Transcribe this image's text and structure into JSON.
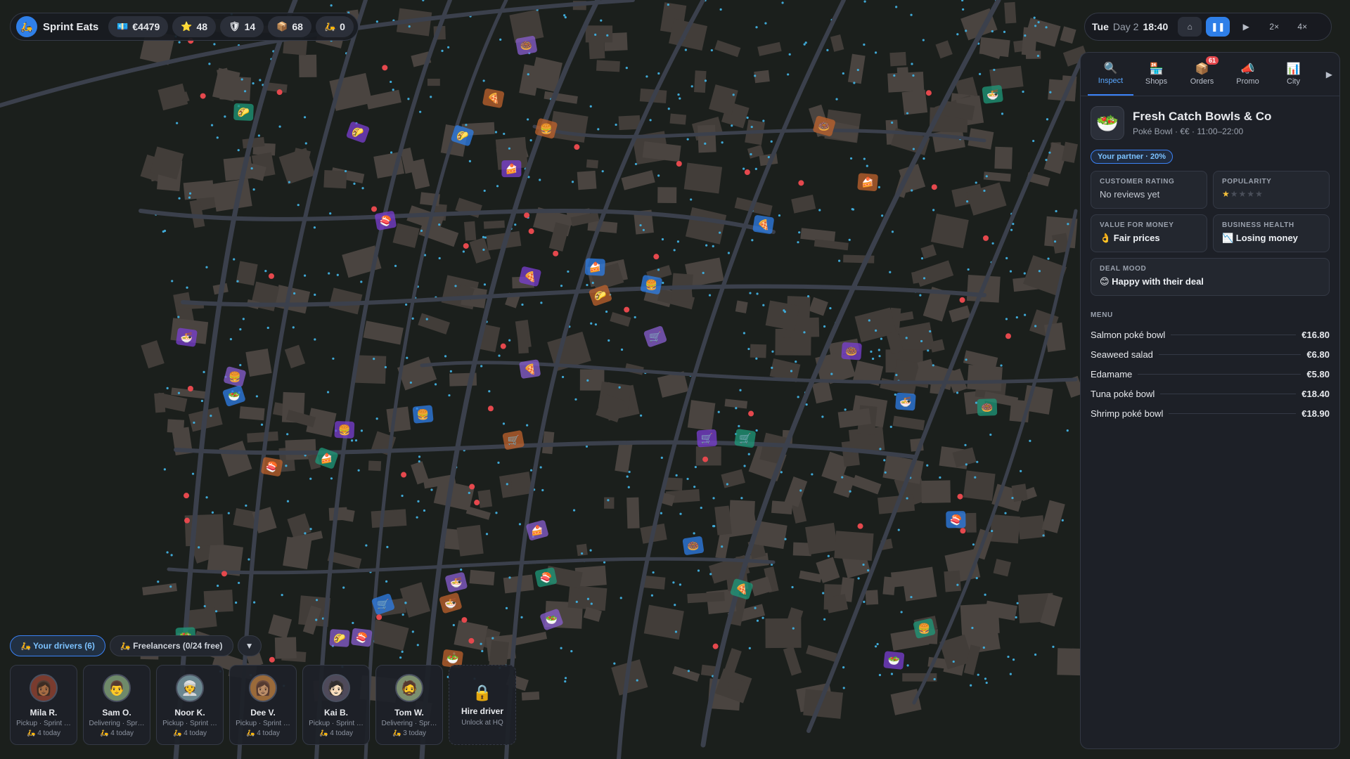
{
  "topbar": {
    "brand": "Sprint Eats",
    "stats": [
      {
        "icon": "cash-icon",
        "glyph": "💶",
        "value": "€4479"
      },
      {
        "icon": "star-icon",
        "glyph": "⭐",
        "value": "48"
      },
      {
        "icon": "shield-icon",
        "glyph": "🛡",
        "value": "14"
      },
      {
        "icon": "package-icon",
        "glyph": "📦",
        "value": "68"
      },
      {
        "icon": "scooter-icon",
        "glyph": "🛵",
        "value": "0"
      }
    ]
  },
  "time": {
    "weekday": "Tue",
    "day": "Day 2",
    "clock": "18:40",
    "home_glyph": "⌂",
    "pause_glyph": "❚❚",
    "play_glyph": "▶",
    "speed2": "2×",
    "speed4": "4×"
  },
  "panel": {
    "tabs": [
      {
        "label": "Inspect",
        "glyph": "🔍",
        "active": true
      },
      {
        "label": "Shops",
        "glyph": "🏪"
      },
      {
        "label": "Orders",
        "glyph": "📦",
        "badge": "61"
      },
      {
        "label": "Promo",
        "glyph": "📣"
      },
      {
        "label": "City",
        "glyph": "📊"
      }
    ],
    "more_glyph": "▶",
    "shop": {
      "icon": "poke-bowl-icon",
      "glyph": "🥗",
      "name": "Fresh Catch Bowls & Co",
      "subtitle": "Poké Bowl · €€ · 11:00–22:00",
      "partner": "Your partner · 20%"
    },
    "cards": {
      "rating_label": "Customer rating",
      "rating_value": "No reviews yet",
      "popularity_label": "Popularity",
      "popularity_stars": 1,
      "value_label": "Value for money",
      "value_value": "👌 Fair prices",
      "health_label": "Business health",
      "health_value": "📉 Losing money",
      "mood_label": "Deal mood",
      "mood_value": "😊 Happy with their deal"
    },
    "menu_title": "Menu",
    "menu": [
      {
        "name": "Salmon poké bowl",
        "price": "€16.80"
      },
      {
        "name": "Seaweed salad",
        "price": "€6.80"
      },
      {
        "name": "Edamame",
        "price": "€5.80"
      },
      {
        "name": "Tuna poké bowl",
        "price": "€18.40"
      },
      {
        "name": "Shrimp poké bowl",
        "price": "€18.90"
      }
    ]
  },
  "driver_tabs": {
    "yours": "🛵 Your drivers (6)",
    "freelancers": "🛵 Freelancers (0/24 free)",
    "toggle": "▼"
  },
  "drivers": [
    {
      "name": "Mila R.",
      "status": "Pickup · Sprint …",
      "today": "🛵 4 today",
      "glyph": "👩🏾",
      "color": "#7a3b2e"
    },
    {
      "name": "Sam O.",
      "status": "Delivering · Spr…",
      "today": "🛵 4 today",
      "glyph": "👨",
      "color": "#6f8a6a"
    },
    {
      "name": "Noor K.",
      "status": "Pickup · Sprint …",
      "today": "🛵 4 today",
      "glyph": "👳",
      "color": "#6b8790"
    },
    {
      "name": "Dee V.",
      "status": "Pickup · Sprint …",
      "today": "🛵 4 today",
      "glyph": "👩🏽",
      "color": "#9a6a3a"
    },
    {
      "name": "Kai B.",
      "status": "Pickup · Sprint …",
      "today": "🛵 4 today",
      "glyph": "🧑🏻",
      "color": "#4f4a5a"
    },
    {
      "name": "Tom W.",
      "status": "Delivering · Spr…",
      "today": "🛵 3 today",
      "glyph": "🧔",
      "color": "#7c8f6f"
    }
  ],
  "hire": {
    "glyph": "🔒",
    "title": "Hire driver",
    "subtitle": "Unlock at HQ"
  },
  "colors": {
    "accent": "#3b82f6",
    "map_bg": "#1b1f1c",
    "road": "#3a3f4b",
    "building": "#4a4440"
  }
}
